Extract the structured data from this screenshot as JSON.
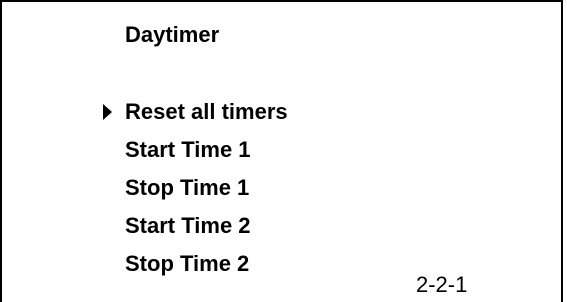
{
  "screen": {
    "title": "Daytimer",
    "page_id": "2-2-1"
  },
  "menu": {
    "selected_index": 0,
    "cursor_icon": "triangle-right-icon",
    "items": [
      {
        "label": "Reset all timers"
      },
      {
        "label": "Start Time 1"
      },
      {
        "label": "Stop Time 1"
      },
      {
        "label": "Start Time 2"
      },
      {
        "label": "Stop Time 2"
      }
    ]
  }
}
